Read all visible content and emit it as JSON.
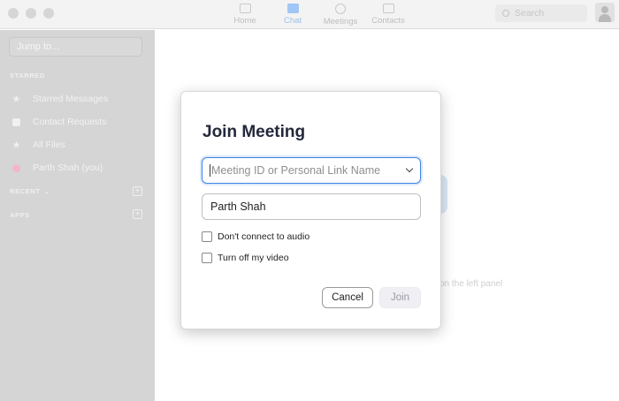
{
  "topbar": {
    "nav": [
      {
        "label": "Home",
        "icon": "home-icon",
        "active": false
      },
      {
        "label": "Chat",
        "icon": "chat-icon",
        "active": true
      },
      {
        "label": "Meetings",
        "icon": "clock-icon",
        "active": false
      },
      {
        "label": "Contacts",
        "icon": "contacts-icon",
        "active": false
      }
    ],
    "search_placeholder": "Search"
  },
  "sidebar": {
    "jump_placeholder": "Jump to...",
    "starred_title": "STARRED",
    "items": [
      {
        "label": "Starred Messages",
        "icon": "star-icon"
      },
      {
        "label": "Contact Requests",
        "icon": "contact-card-icon"
      },
      {
        "label": "All Files",
        "icon": "file-icon"
      },
      {
        "label": "Parth Shah  (you)",
        "icon": "avatar-icon"
      }
    ],
    "recent_title": "RECENT",
    "apps_title": "APPS"
  },
  "main": {
    "background_hint": "on the left panel"
  },
  "dialog": {
    "title": "Join Meeting",
    "meeting_id_placeholder": "Meeting ID or Personal Link Name",
    "name_value": "Parth Shah",
    "checkbox_audio_label": "Don't connect to audio",
    "checkbox_video_label": "Turn off my video",
    "cancel_label": "Cancel",
    "join_label": "Join"
  },
  "colors": {
    "accent": "#3f84e5",
    "sidebar_bg": "#d5d5d5",
    "title_color": "#23283b",
    "join_disabled_bg": "#efeff4"
  }
}
